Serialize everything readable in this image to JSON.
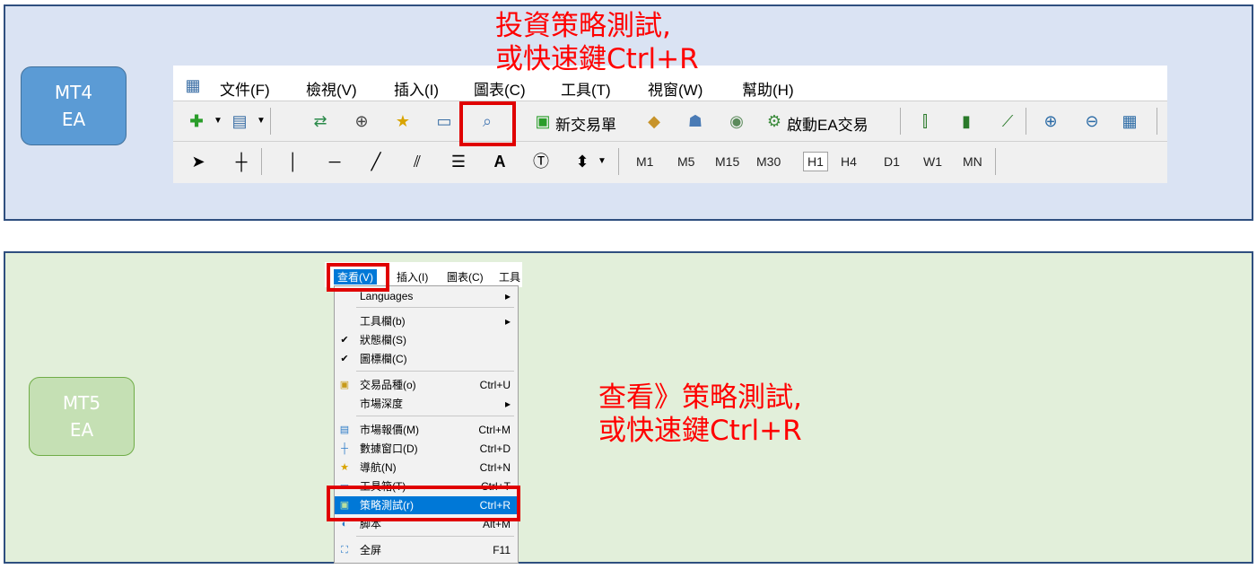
{
  "mt4": {
    "badge_line1": "MT4",
    "badge_line2": "EA",
    "note_line1": "投資策略測試,",
    "note_line2": "或快速鍵Ctrl+R",
    "menu": [
      "文件(F)",
      "檢視(V)",
      "插入(I)",
      "圖表(C)",
      "工具(T)",
      "視窗(W)",
      "幫助(H)"
    ],
    "new_order_label": "新交易單",
    "autotrade_label": "啟動EA交易",
    "timeframes": [
      "M1",
      "M5",
      "M15",
      "M30",
      "H1",
      "H4",
      "D1",
      "W1",
      "MN"
    ],
    "text_tool": "A"
  },
  "mt5": {
    "badge_line1": "MT5",
    "badge_line2": "EA",
    "note_line1": "查看》策略測試,",
    "note_line2": "或快速鍵Ctrl+R",
    "menu": [
      "查看(V)",
      "插入(I)",
      "圖表(C)",
      "工具"
    ],
    "items": [
      {
        "label": "Languages",
        "shortcut": "",
        "submenu": true
      },
      {
        "label": "工具欄(b)",
        "shortcut": "",
        "submenu": true
      },
      {
        "label": "狀態欄(S)",
        "shortcut": "",
        "checked": true
      },
      {
        "label": "圖標欄(C)",
        "shortcut": "",
        "checked": true
      },
      {
        "label": "交易品種(o)",
        "shortcut": "Ctrl+U"
      },
      {
        "label": "市場深度",
        "shortcut": "",
        "submenu": true
      },
      {
        "label": "市場報價(M)",
        "shortcut": "Ctrl+M"
      },
      {
        "label": "數據窗口(D)",
        "shortcut": "Ctrl+D"
      },
      {
        "label": "導航(N)",
        "shortcut": "Ctrl+N"
      },
      {
        "label": "工具箱(T)",
        "shortcut": "Ctrl+T"
      },
      {
        "label": "策略測試(r)",
        "shortcut": "Ctrl+R",
        "highlighted": true
      },
      {
        "label": "脚本",
        "shortcut": "Alt+M"
      },
      {
        "label": "全屏",
        "shortcut": "F11"
      }
    ],
    "check_mark": "✔",
    "submenu_arrow": "▸"
  },
  "colors": {
    "mt4_panel": "#dae3f3",
    "mt5_panel": "#e2efda",
    "highlight_box": "#e00000",
    "note_text": "#ff0000",
    "menu_highlight": "#0078d7"
  }
}
